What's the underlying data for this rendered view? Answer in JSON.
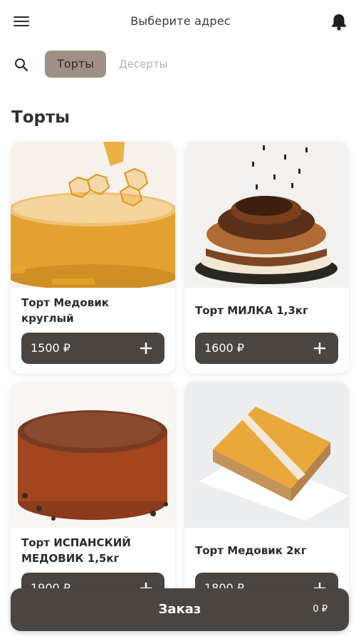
{
  "header": {
    "address_label": "Выберите адрес",
    "icons": {
      "menu": "hamburger-menu-icon",
      "notifications": "bell-icon",
      "search": "search-icon"
    }
  },
  "categories": {
    "active": "Торты",
    "inactive": "Десерты"
  },
  "section_title": "Торты",
  "products": [
    {
      "title": "Торт Медовик круглый",
      "price": "1500 ₽",
      "image": "honey-cake-round"
    },
    {
      "title": "Торт МИЛКА 1,3кг",
      "price": "1600 ₽",
      "image": "milka-chocolate-cake"
    },
    {
      "title": "Торт ИСПАНСКИЙ МЕДОВИК 1,5кг",
      "price": "1900 ₽",
      "image": "spanish-honey-cake"
    },
    {
      "title": "Торт Медовик 2кг",
      "price": "1800 ₽",
      "image": "honey-cake-square"
    }
  ],
  "order_bar": {
    "label": "Заказ",
    "total": "0 ₽"
  },
  "colors": {
    "accent_dark": "#4a4541",
    "tab_active_bg": "#a09187",
    "tab_inactive_text": "#b5b1ae"
  }
}
